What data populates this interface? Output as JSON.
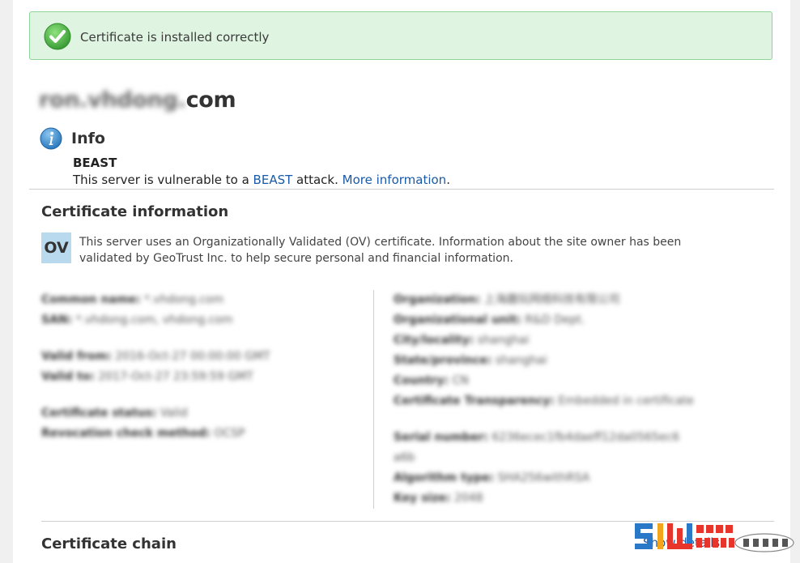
{
  "banner": {
    "message": "Certificate is installed correctly",
    "status_color": "#53b54f"
  },
  "domain": {
    "blurred_part": "ron.vhdong.",
    "suffix": "com"
  },
  "info": {
    "heading": "Info",
    "vulnerability_title": "BEAST",
    "text_before": "This server is vulnerable to a ",
    "beast_link": "BEAST",
    "text_middle": " attack. ",
    "more_link": "More information",
    "text_after": "."
  },
  "cert_info": {
    "title": "Certificate information",
    "badge": "OV",
    "description": "This server uses an Organizationally Validated (OV) certificate. Information about the site owner has been validated by GeoTrust Inc. to help secure personal and financial information."
  },
  "left_details": [
    {
      "label": "Common name:",
      "value": "*.vhdong.com"
    },
    {
      "label": "SAN:",
      "value": "*.vhdong.com, vhdong.com"
    },
    {
      "label": "Valid from:",
      "value": "2016-Oct-27 00:00:00 GMT"
    },
    {
      "label": "Valid to:",
      "value": "2017-Oct-27 23:59:59 GMT"
    },
    {
      "label": "Certificate status:",
      "value": "Valid"
    },
    {
      "label": "Revocation check method:",
      "value": "OCSP"
    }
  ],
  "right_details": [
    {
      "label": "Organization:",
      "value": "上海趣玩网络科技有限公司"
    },
    {
      "label": "Organizational unit:",
      "value": "R&D Dept."
    },
    {
      "label": "City/locality:",
      "value": "shanghai"
    },
    {
      "label": "State/province:",
      "value": "shanghai"
    },
    {
      "label": "Country:",
      "value": "CN"
    },
    {
      "label": "Certificate Transparency:",
      "value": "Embedded in certificate"
    },
    {
      "label": "Serial number:",
      "value": "6236ecec1fb4daeff12da0565ec6"
    },
    {
      "label": "",
      "value": "a6b"
    },
    {
      "label": "Algorithm type:",
      "value": "SHA256withRSA"
    },
    {
      "label": "Key size:",
      "value": "2048"
    }
  ],
  "cert_chain": {
    "title": "Certificate chain",
    "show_details": "Show details"
  },
  "icons": {
    "success": "check-circle-icon",
    "info": "info-circle-icon"
  }
}
